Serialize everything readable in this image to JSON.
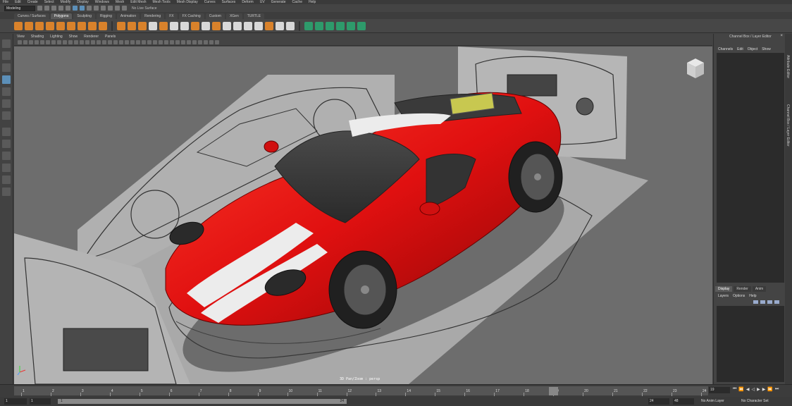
{
  "menu": [
    "File",
    "Edit",
    "Create",
    "Select",
    "Modify",
    "Display",
    "Windows",
    "Mesh",
    "Edit Mesh",
    "Mesh Tools",
    "Mesh Display",
    "Curves",
    "Surfaces",
    "Deform",
    "UV",
    "Generate",
    "Cache",
    "Help"
  ],
  "statusline": {
    "mode": "Modeling",
    "live_surface": "No Live Surface"
  },
  "shelf_tabs": [
    "Curves / Surfaces",
    "Polygons",
    "Sculpting",
    "Rigging",
    "Animation",
    "Rendering",
    "FX",
    "FX Caching",
    "Custom",
    "XGen",
    "TURTLE"
  ],
  "shelf_active": "Polygons",
  "viewport_menu": [
    "View",
    "Shading",
    "Lighting",
    "Show",
    "Renderer",
    "Panels"
  ],
  "hud": {
    "camera": "3D Pan/Zoom : persp"
  },
  "channel_box": {
    "title": "Channel Box / Layer Editor",
    "menu": [
      "Channels",
      "Edit",
      "Object",
      "Show"
    ],
    "layer_tabs": [
      "Display",
      "Render",
      "Anim"
    ],
    "layer_active": "Display",
    "layer_menu": [
      "Layers",
      "Options",
      "Help"
    ]
  },
  "side_tabs": [
    "Attribute Editor",
    "Channel Box / Layer Editor"
  ],
  "timeline": {
    "ticks": [
      "1",
      "2",
      "3",
      "4",
      "5",
      "6",
      "7",
      "8",
      "9",
      "10",
      "11",
      "12",
      "13",
      "14",
      "15",
      "16",
      "17",
      "18",
      "19",
      "20",
      "21",
      "22",
      "23",
      "24"
    ],
    "current_frame": "19",
    "marker_label": "19"
  },
  "range": {
    "start": "1",
    "start_inner": "1",
    "slider_start": "1",
    "slider_end": "24",
    "end_inner": "24",
    "end": "48",
    "anim_layer": "No Anim Layer",
    "char_set": "No Character Set"
  },
  "colors": {
    "car_red": "#e01010",
    "stripe": "#e8e8e8",
    "viewport_bg": "#6d6d6d",
    "accent_blue": "#5c8fb8"
  }
}
